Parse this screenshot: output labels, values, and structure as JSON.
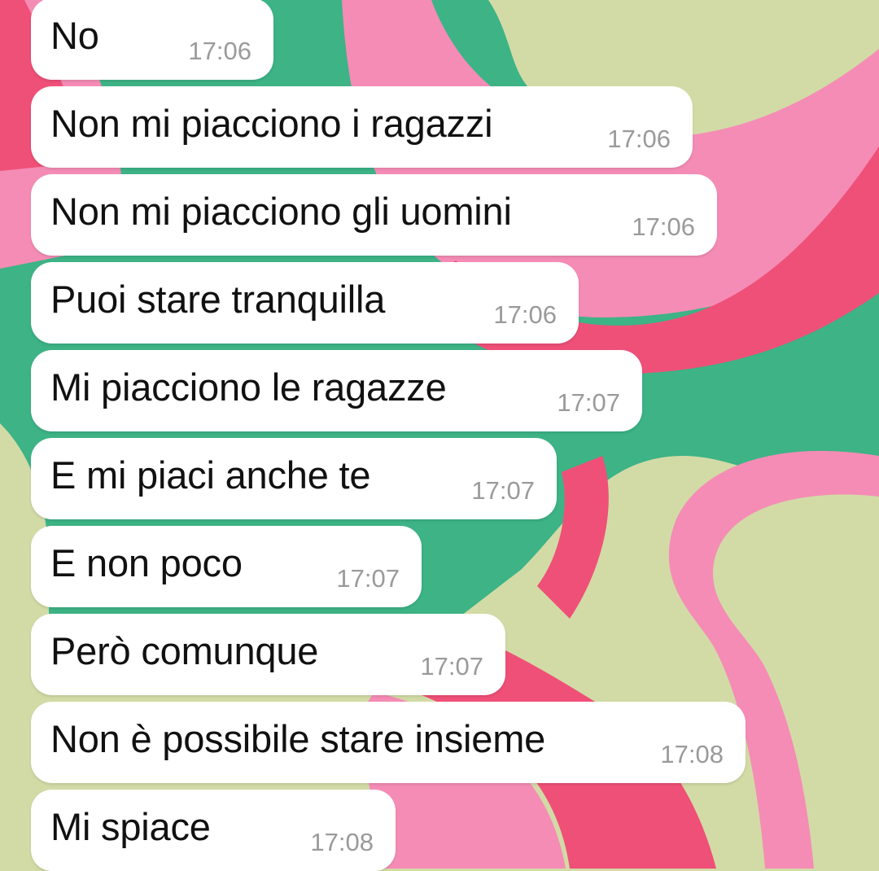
{
  "colors": {
    "wallpaper_sage": "#d2dba6",
    "wallpaper_green": "#3db386",
    "wallpaper_pink": "#f58cb5",
    "wallpaper_red": "#ef5078",
    "bubble": "#ffffff",
    "text": "#111111",
    "timestamp": "#9a9a9a"
  },
  "messages": [
    {
      "text": "No",
      "time": "17:06"
    },
    {
      "text": "Non mi piacciono i ragazzi",
      "time": "17:06"
    },
    {
      "text": "Non mi piacciono gli uomini",
      "time": "17:06"
    },
    {
      "text": "Puoi stare tranquilla",
      "time": "17:06"
    },
    {
      "text": "Mi piacciono le ragazze",
      "time": "17:07"
    },
    {
      "text": "E mi piaci anche te",
      "time": "17:07"
    },
    {
      "text": "E non poco",
      "time": "17:07"
    },
    {
      "text": "Però comunque",
      "time": "17:07"
    },
    {
      "text": "Non è possibile stare insieme",
      "time": "17:08"
    },
    {
      "text": "Mi spiace",
      "time": "17:08"
    }
  ]
}
